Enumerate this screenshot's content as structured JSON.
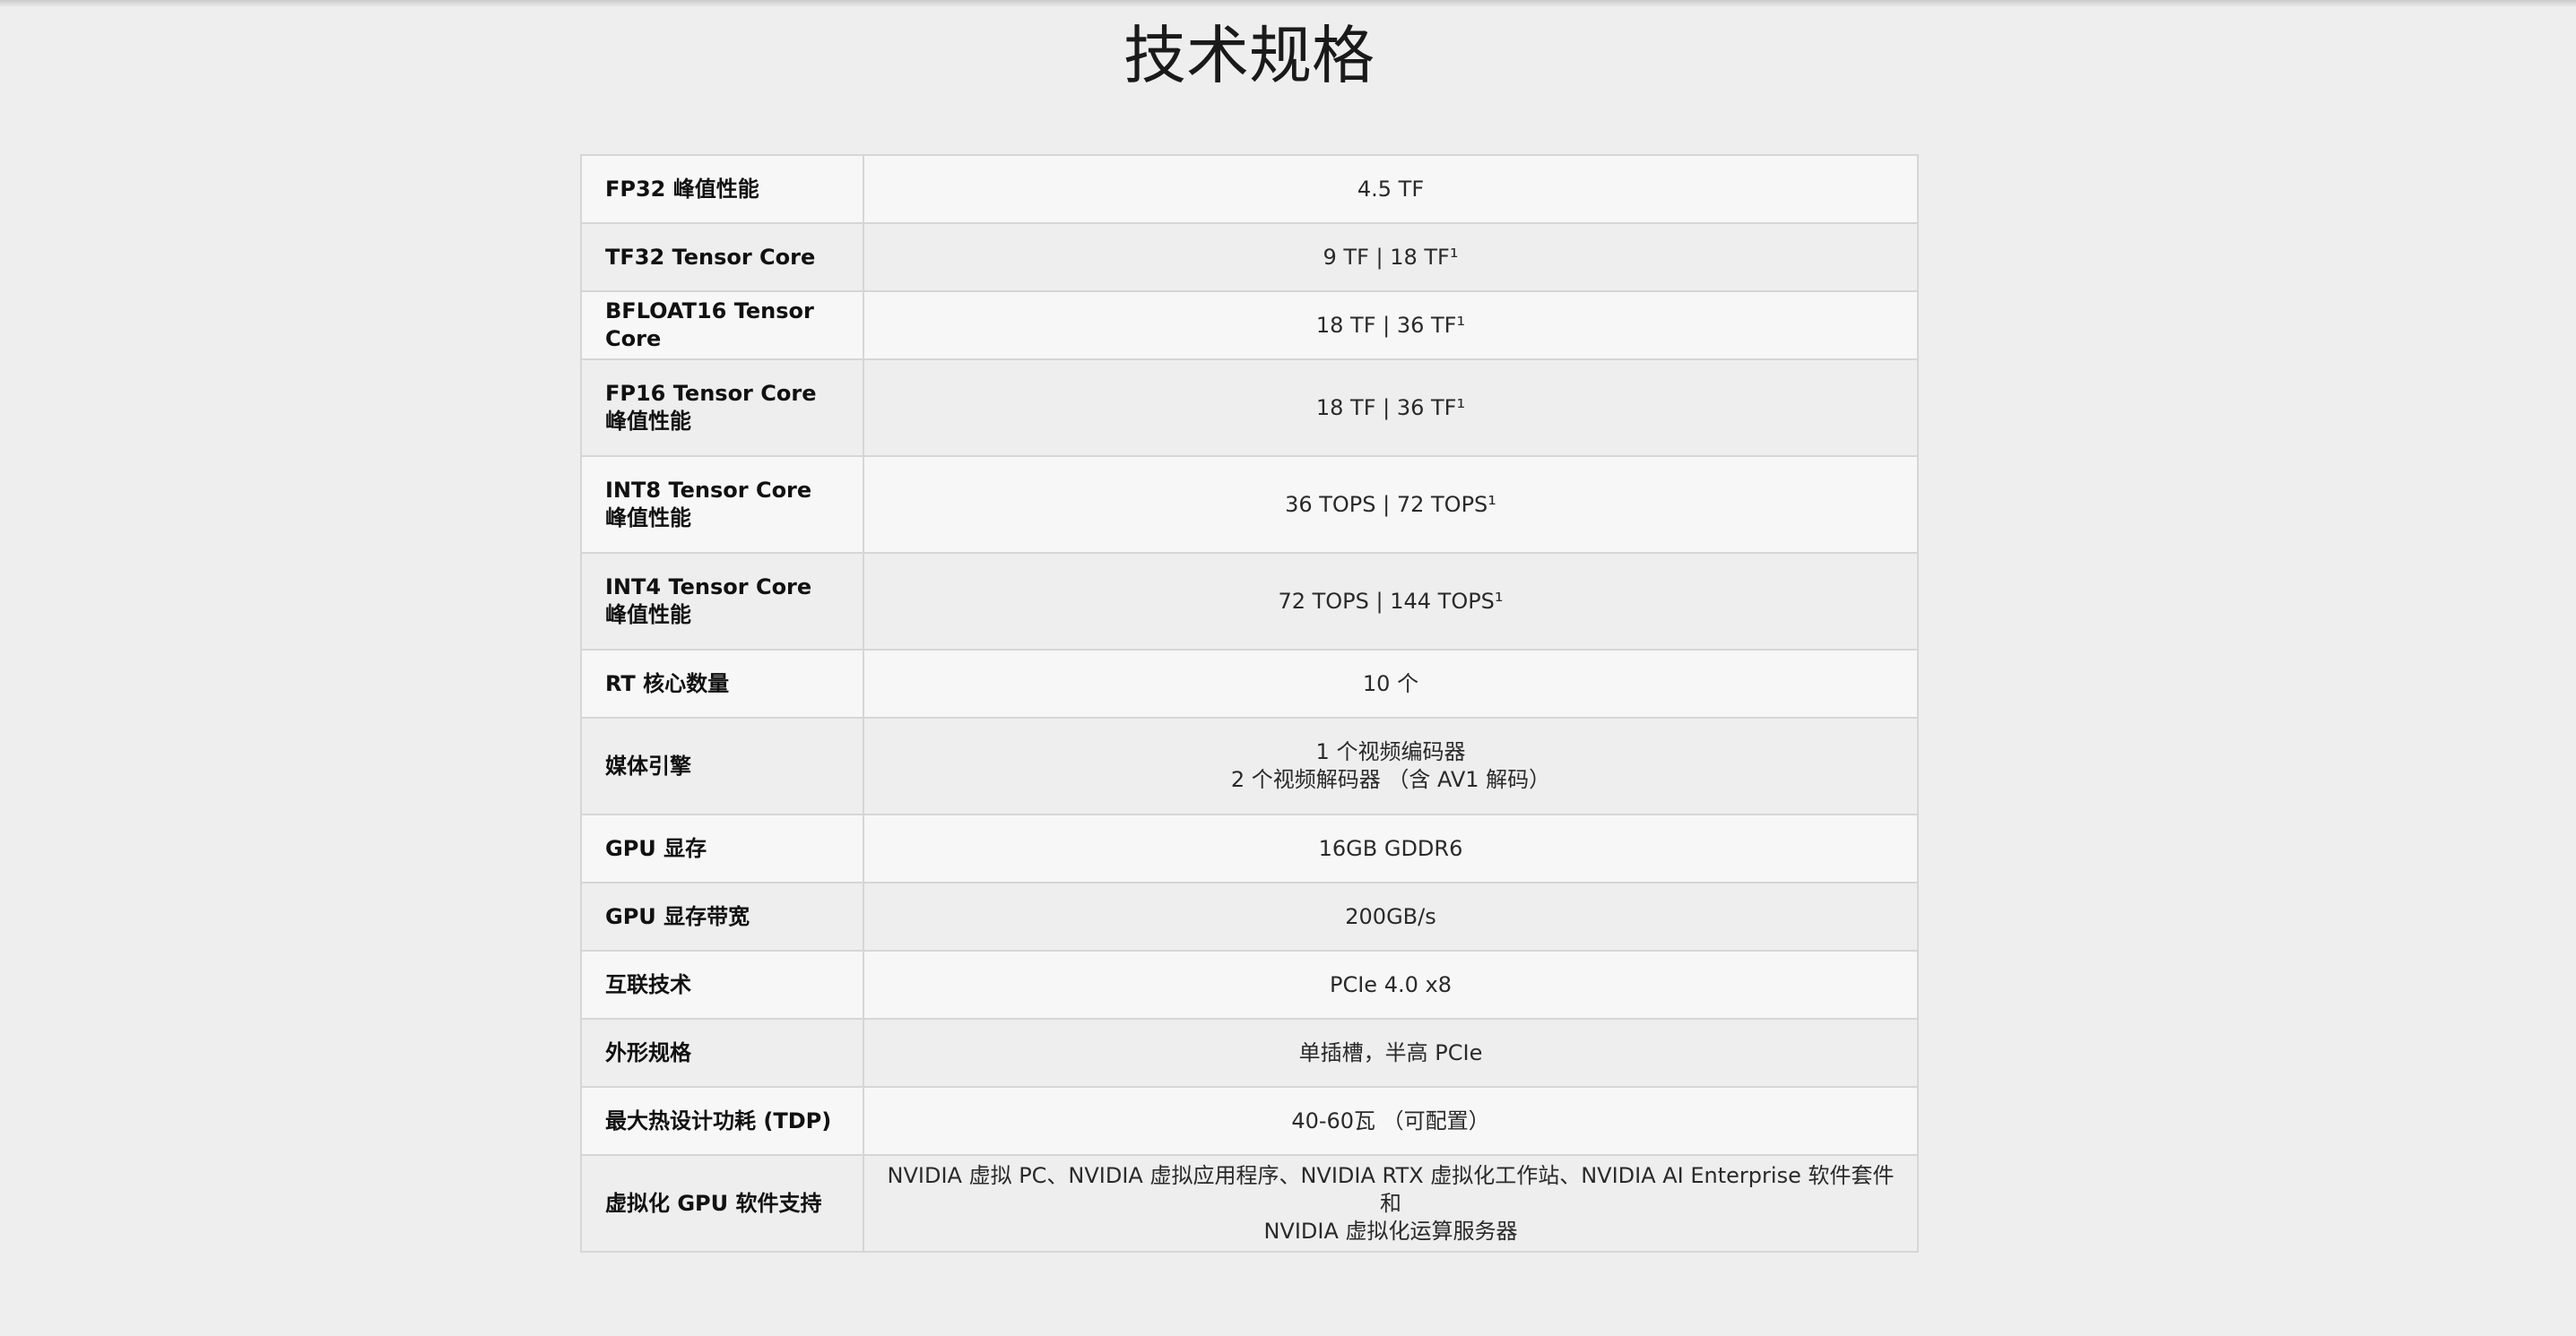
{
  "page": {
    "title": "技术规格"
  },
  "specs": [
    {
      "label": "FP32 峰值性能",
      "value": "4.5 TF"
    },
    {
      "label": "TF32 Tensor Core",
      "value": "9 TF | 18 TF¹"
    },
    {
      "label": "BFLOAT16 Tensor Core",
      "value": "18 TF | 36 TF¹"
    },
    {
      "label": "FP16 Tensor Core 峰值性能",
      "value": "18 TF | 36 TF¹"
    },
    {
      "label": "INT8 Tensor Core 峰值性能",
      "value": "36 TOPS | 72 TOPS¹"
    },
    {
      "label": "INT4 Tensor Core 峰值性能",
      "value": "72 TOPS | 144 TOPS¹"
    },
    {
      "label": "RT 核心数量",
      "value": "10 个"
    },
    {
      "label": "媒体引擎",
      "value": "1 个视频编码器\n2 个视频解码器 （含 AV1 解码）"
    },
    {
      "label": "GPU 显存",
      "value": "16GB GDDR6"
    },
    {
      "label": "GPU 显存带宽",
      "value": "200GB/s"
    },
    {
      "label": "互联技术",
      "value": "PCIe 4.0 x8"
    },
    {
      "label": "外形规格",
      "value": "单插槽，半高 PCIe"
    },
    {
      "label": "最大热设计功耗 (TDP)",
      "value": "40-60瓦 （可配置）"
    },
    {
      "label": "虚拟化 GPU 软件支持",
      "value": "NVIDIA 虚拟 PC、NVIDIA 虚拟应用程序、NVIDIA RTX 虚拟化工作站、NVIDIA AI Enterprise 软件套件和\nNVIDIA 虚拟化运算服务器"
    }
  ]
}
